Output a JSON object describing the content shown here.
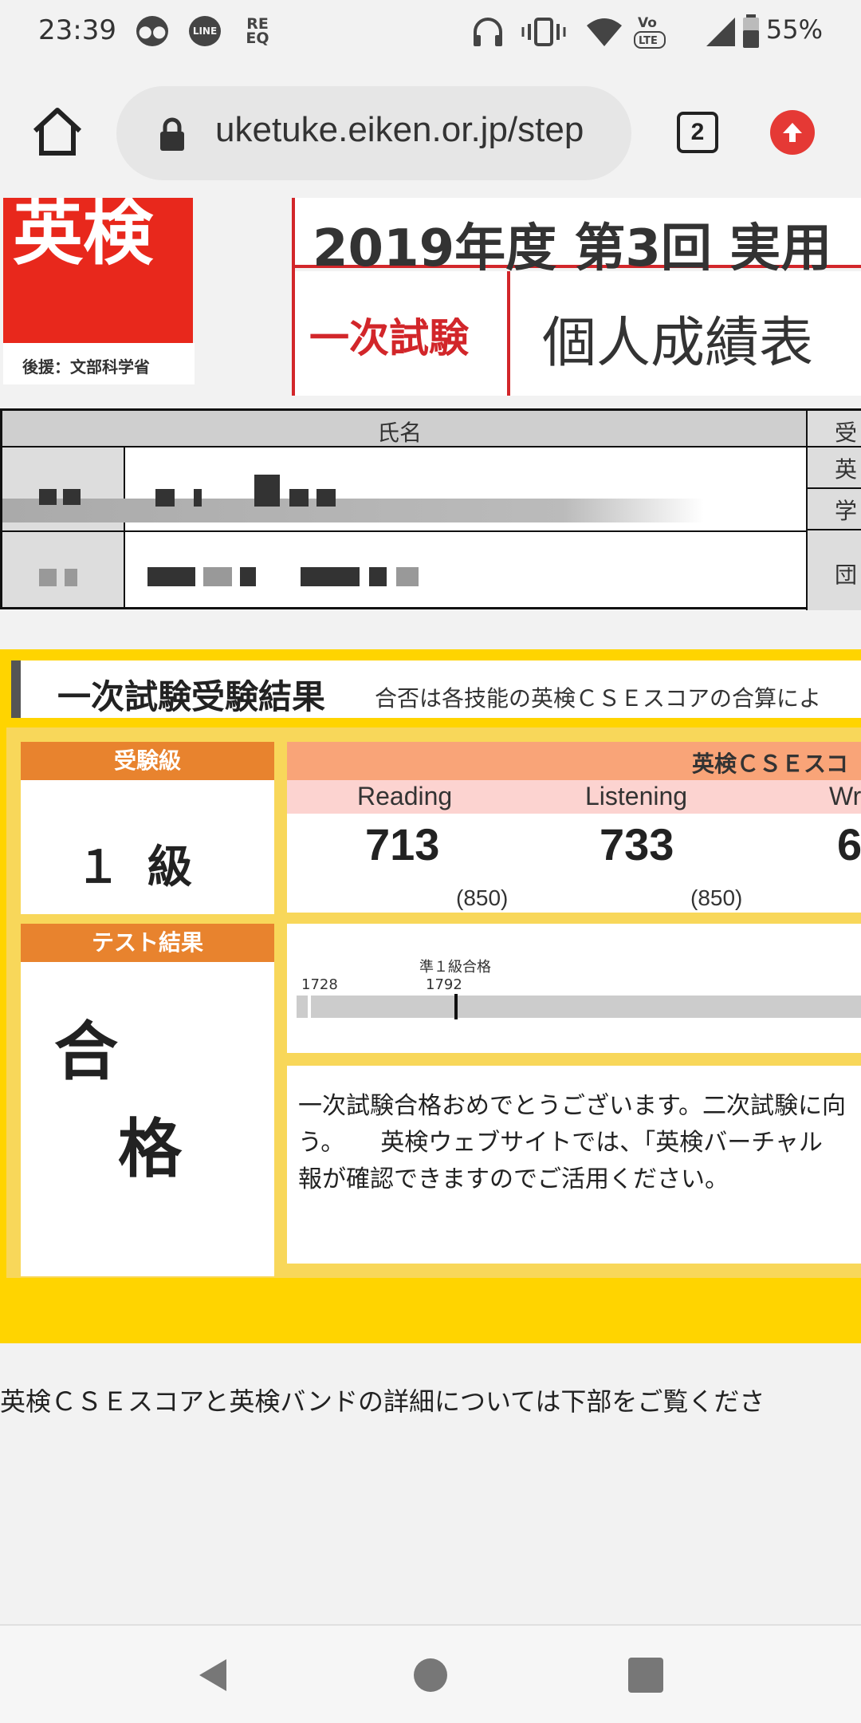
{
  "status_bar": {
    "time": "23:39",
    "notif_icons": [
      "messenger-icon",
      "line-icon",
      "reeq-icon"
    ],
    "line_label": "LINE",
    "reeq_label": "RE\nEQ",
    "system_icons": [
      "headphones-icon",
      "vibrate-icon",
      "wifi-icon",
      "volte-icon",
      "signal-icon",
      "battery-icon"
    ],
    "battery": "55%"
  },
  "browser": {
    "url": "uketuke.eiken.or.jp/step",
    "tab_count": "2"
  },
  "header": {
    "logo_text": "英検",
    "logo_sub": "後援：文部科学省",
    "title": "2019年度 第3回 実用",
    "first_exam_label": "一次試験",
    "report_label": "個人成績表"
  },
  "name_table": {
    "name_header": "氏名",
    "right_labels": [
      "受",
      "英",
      "学",
      "団"
    ]
  },
  "results": {
    "section_title": "一次試験受験結果",
    "section_note": "合否は各技能の英検ＣＳＥスコアの合算によ",
    "grade_label": "受験級",
    "grade_value": "１級",
    "test_result_label": "テスト結果",
    "test_result_value_1": "合",
    "test_result_value_2": "格",
    "cse_header": "英検ＣＳＥスコ",
    "skills": [
      {
        "name": "Reading",
        "score": "713",
        "max": "(850)"
      },
      {
        "name": "Listening",
        "score": "733",
        "max": "(850)"
      },
      {
        "name": "Wr",
        "score": "6",
        "max": ""
      }
    ],
    "band": {
      "label_pass": "準１級合格",
      "tick_1": "1728",
      "tick_2": "1792"
    },
    "message": "一次試験合格おめでとうございます。二次試験に向\nう。　　英検ウェブサイトでは、「英検バーチャル\n報が確認できますのでご活用ください。"
  },
  "footnote": "英検ＣＳＥスコアと英検バンドの詳細については下部をご覧くださ",
  "colors": {
    "eiken_red": "#e8281c",
    "header_red": "#d2262a",
    "results_yellow": "#ffd400",
    "tag_orange": "#e8832e",
    "cse_salmon": "#f9a478",
    "cse_pink": "#fcd3d0"
  }
}
